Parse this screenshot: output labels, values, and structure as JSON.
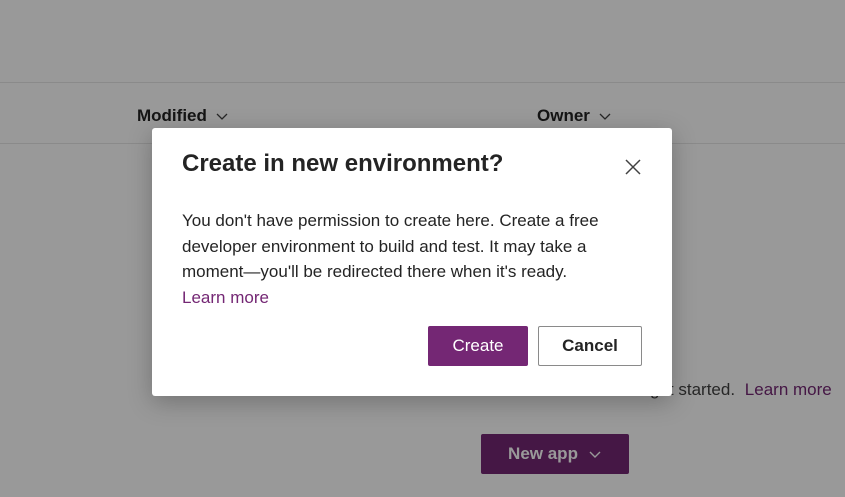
{
  "background": {
    "columns": {
      "modified_label": "Modified",
      "owner_label": "Owner"
    },
    "partial_text": "get started.",
    "learn_more": "Learn more",
    "new_app_label": "New app"
  },
  "dialog": {
    "title": "Create in new environment?",
    "body": "You don't have permission to create here. Create a free developer environment to build and test. It may take a moment—you'll be redirected there when it's ready.",
    "learn_more": "Learn more",
    "create_label": "Create",
    "cancel_label": "Cancel",
    "close_icon": "close-icon"
  },
  "colors": {
    "accent": "#742774",
    "overlay": "rgba(0,0,0,0.4)",
    "text": "#242424"
  }
}
